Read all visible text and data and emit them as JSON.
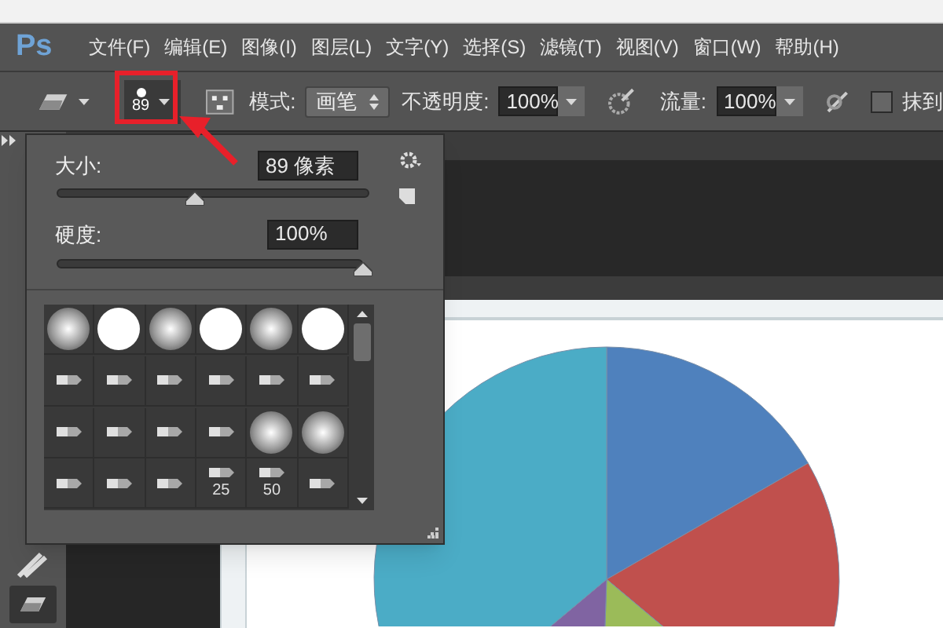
{
  "menubar": {
    "logo": "Ps",
    "items": [
      "文件(F)",
      "编辑(E)",
      "图像(I)",
      "图层(L)",
      "文字(Y)",
      "选择(S)",
      "滤镜(T)",
      "视图(V)",
      "窗口(W)",
      "帮助(H)"
    ]
  },
  "options_bar": {
    "brush_size": "89",
    "mode_label": "模式:",
    "mode_value": "画笔",
    "opacity_label": "不透明度:",
    "opacity_value": "100%",
    "flow_label": "流量:",
    "flow_value": "100%",
    "erase_history": {
      "label": "抹到",
      "checked": false
    }
  },
  "brush_panel": {
    "size_label": "大小:",
    "size_value": "89 像素",
    "size_slider": {
      "level": 0.44
    },
    "hardness_label": "硬度:",
    "hardness_value": "100%",
    "hardness_slider": {
      "level": 1.0
    },
    "presets": [
      {
        "kind": "soft"
      },
      {
        "kind": "hard"
      },
      {
        "kind": "soft"
      },
      {
        "kind": "hard"
      },
      {
        "kind": "soft"
      },
      {
        "kind": "hard"
      },
      {
        "kind": "tip"
      },
      {
        "kind": "tip"
      },
      {
        "kind": "tip"
      },
      {
        "kind": "tip"
      },
      {
        "kind": "tip"
      },
      {
        "kind": "tip"
      },
      {
        "kind": "tip"
      },
      {
        "kind": "tip"
      },
      {
        "kind": "tip"
      },
      {
        "kind": "tip"
      },
      {
        "kind": "soft"
      },
      {
        "kind": "soft"
      },
      {
        "kind": "tip"
      },
      {
        "kind": "tip"
      },
      {
        "kind": "tip"
      },
      {
        "kind": "tip",
        "label": "25"
      },
      {
        "kind": "tip",
        "label": "50"
      },
      {
        "kind": "tip"
      }
    ]
  }
}
